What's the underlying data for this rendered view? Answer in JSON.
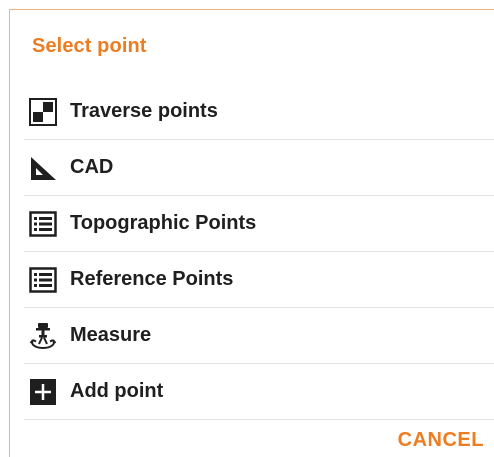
{
  "dialog": {
    "title": "Select point",
    "accent_color": "#ee7d22",
    "items": [
      {
        "label": "Traverse points",
        "icon": "traverse-points-icon"
      },
      {
        "label": "CAD",
        "icon": "set-square-icon"
      },
      {
        "label": "Topographic Points",
        "icon": "list-icon"
      },
      {
        "label": "Reference Points",
        "icon": "list-icon"
      },
      {
        "label": "Measure",
        "icon": "total-station-icon"
      },
      {
        "label": "Add point",
        "icon": "plus-icon"
      }
    ],
    "cancel_label": "CANCEL"
  }
}
